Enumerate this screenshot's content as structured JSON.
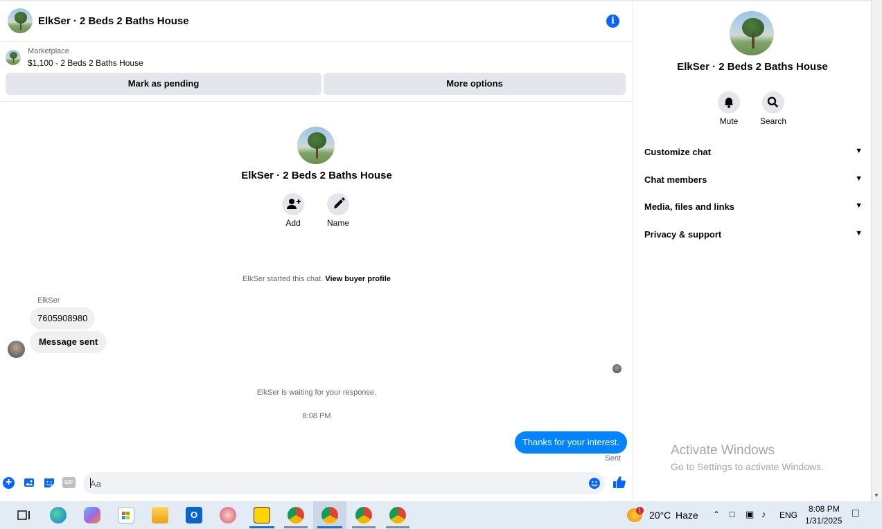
{
  "header": {
    "title": "ElkSer · 2 Beds 2 Baths House",
    "info_icon": "info-icon"
  },
  "marketplace": {
    "label": "Marketplace",
    "listing": "$1,100 - 2 Beds 2 Baths House",
    "mark_pending": "Mark as pending",
    "more_options": "More options"
  },
  "profile": {
    "name": "ElkSer · 2 Beds 2 Baths House",
    "add_label": "Add",
    "name_label": "Name"
  },
  "thread": {
    "started_text": "ElkSer started this chat.",
    "view_buyer": "View buyer profile",
    "sender_name": "ElkSer",
    "msg1": "7605908980",
    "msg2": "Message sent",
    "waiting": "ElkSer is waiting for your response.",
    "time": "8:08 PM",
    "outgoing": "Thanks for your interest.",
    "status": "Sent"
  },
  "composer": {
    "placeholder": "Aa"
  },
  "side": {
    "title": "ElkSer · 2 Beds 2 Baths House",
    "mute": "Mute",
    "search": "Search",
    "sections": [
      "Customize chat",
      "Chat members",
      "Media, files and links",
      "Privacy & support"
    ]
  },
  "watermark": {
    "line1": "Activate Windows",
    "line2": "Go to Settings to activate Windows."
  },
  "taskbar": {
    "weather_temp": "20°C",
    "weather_desc": "Haze",
    "weather_badge": "1",
    "lang": "ENG",
    "time": "8:08 PM",
    "date": "1/31/2025"
  },
  "colors": {
    "accent": "#0866ff",
    "bubble_out": "#0084ff",
    "bubble_in": "#f0f0f0"
  }
}
